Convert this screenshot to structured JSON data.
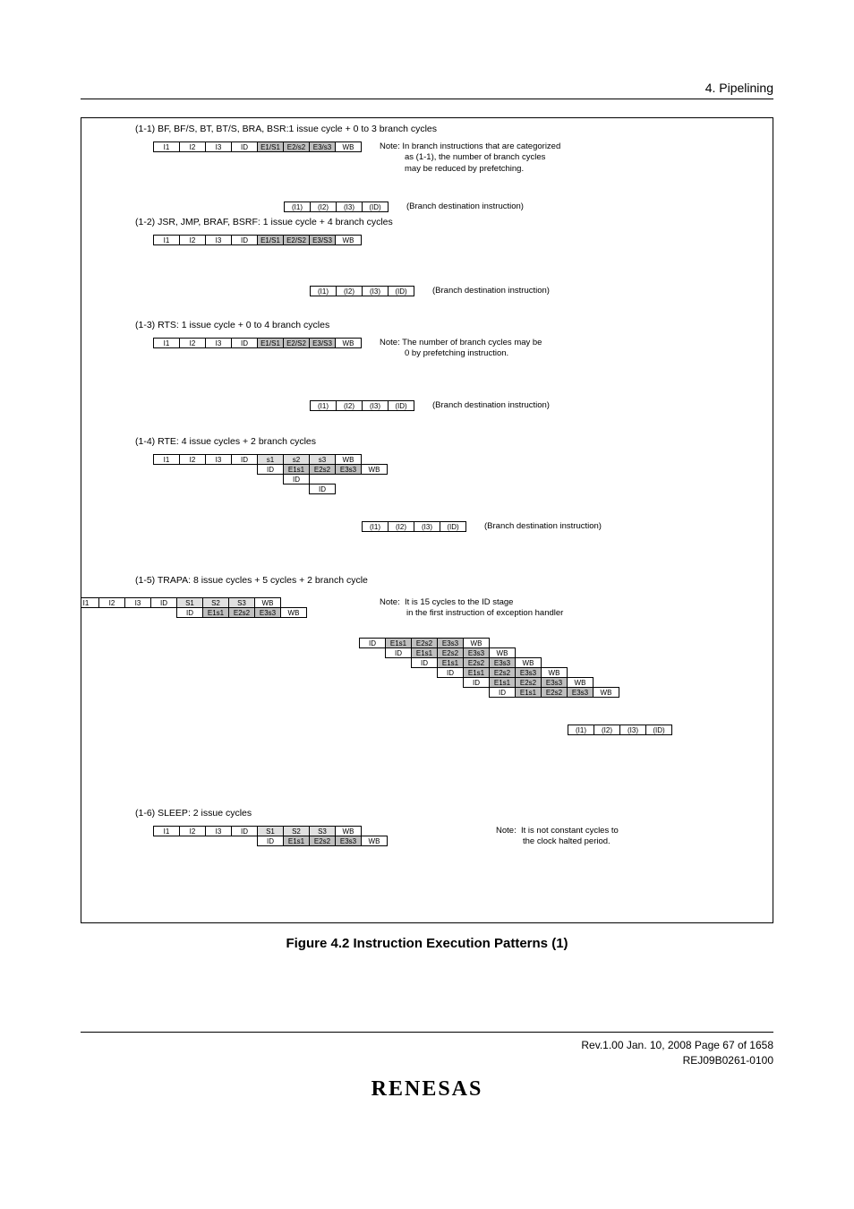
{
  "page": {
    "header_chapter": "4.   Pipelining",
    "figure_caption": "Figure 4.2   Instruction Execution Patterns (1)",
    "footer_rev": "Rev.1.00  Jan. 10, 2008  Page 67 of 1658",
    "footer_doc": "REJ09B0261-0100",
    "logo": "RENESAS"
  },
  "sections": {
    "s11": {
      "title": "(1-1) BF, BF/S, BT, BT/S, BRA, BSR:1 issue cycle + 0 to 3 branch cycles",
      "main_stages": [
        "I1",
        "I2",
        "I3",
        "ID",
        "E1/S1",
        "E2/s2",
        "E3/s3",
        "WB"
      ],
      "branch_dest": [
        "(I1)",
        "(I2)",
        "(I3)",
        "(ID)"
      ],
      "note1": "Note: In branch instructions that are categorized",
      "note2": "as (1-1), the number of branch cycles",
      "note3": "may be reduced by prefetching.",
      "branch_label": "(Branch destination instruction)"
    },
    "s12": {
      "title": "(1-2) JSR, JMP, BRAF, BSRF: 1 issue cycle + 4 branch cycles",
      "main_stages": [
        "I1",
        "I2",
        "I3",
        "ID",
        "E1/S1",
        "E2/S2",
        "E3/S3",
        "WB"
      ],
      "branch_dest": [
        "(I1)",
        "(I2)",
        "(I3)",
        "(ID)"
      ],
      "branch_label": "(Branch destination instruction)"
    },
    "s13": {
      "title": "(1-3) RTS: 1 issue cycle + 0 to 4 branch cycles",
      "main_stages": [
        "I1",
        "I2",
        "I3",
        "ID",
        "E1/S1",
        "E2/S2",
        "E3/S3",
        "WB"
      ],
      "branch_dest": [
        "(I1)",
        "(I2)",
        "(I3)",
        "(ID)"
      ],
      "note1": "Note: The number of branch cycles may be",
      "note2": "0 by prefetching instruction.",
      "branch_label": "(Branch destination instruction)"
    },
    "s14": {
      "title": "(1-4) RTE: 4 issue cycles + 2 branch cycles",
      "row1": [
        "I1",
        "I2",
        "I3",
        "ID",
        "s1",
        "s2",
        "s3",
        "WB"
      ],
      "row2": [
        "ID",
        "E1s1",
        "E2s2",
        "E3s3",
        "WB"
      ],
      "row3": [
        "ID"
      ],
      "row4": [
        "ID"
      ],
      "branch_dest": [
        "(I1)",
        "(I2)",
        "(I3)",
        "(ID)"
      ],
      "branch_label": "(Branch destination instruction)"
    },
    "s15": {
      "title": "(1-5) TRAPA: 8 issue cycles + 5 cycles + 2 branch cycle",
      "row1": [
        "I1",
        "I2",
        "I3",
        "ID",
        "S1",
        "S2",
        "S3",
        "WB"
      ],
      "row2": [
        "ID",
        "E1s1",
        "E2s2",
        "E3s3",
        "WB"
      ],
      "blockA": [
        "ID",
        "E1s1",
        "E2s2",
        "E3s3",
        "WB"
      ],
      "blockB": [
        "ID",
        "E1s1",
        "E2s2",
        "E3s3",
        "WB"
      ],
      "blockC": [
        "ID",
        "E1s1",
        "E2s2",
        "E3s3",
        "WB"
      ],
      "blockD": [
        "ID",
        "E1s1",
        "E2s2",
        "E3s3",
        "WB"
      ],
      "blockE": [
        "ID",
        "E1s1",
        "E2s2",
        "E3s3",
        "WB"
      ],
      "blockF": [
        "ID",
        "E1s1",
        "E2s2",
        "E3s3",
        "WB"
      ],
      "branch_dest": [
        "(I1)",
        "(I2)",
        "(I3)",
        "(ID)"
      ],
      "note_label": "Note:",
      "note1": "It is 15 cycles to the ID stage",
      "note2": "in the first instruction of exception handler"
    },
    "s16": {
      "title": "(1-6) SLEEP: 2 issue cycles",
      "row1": [
        "I1",
        "I2",
        "I3",
        "ID",
        "S1",
        "S2",
        "S3",
        "WB"
      ],
      "row2": [
        "ID",
        "E1s1",
        "E2s2",
        "E3s3",
        "WB"
      ],
      "note_label": "Note:",
      "note1": "It is not constant cycles to",
      "note2": "the clock halted period."
    }
  }
}
